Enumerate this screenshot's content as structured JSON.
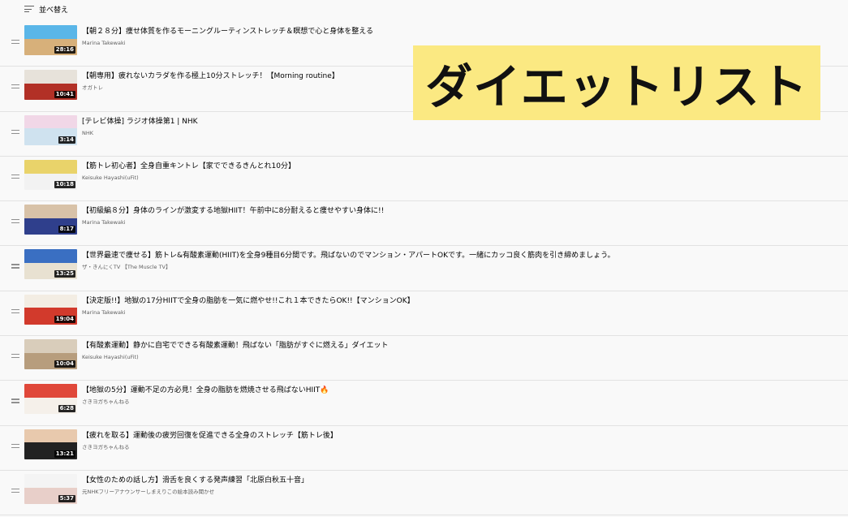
{
  "sort": {
    "label": "並べ替え"
  },
  "overlay": {
    "text": "ダイエットリスト"
  },
  "videos": [
    {
      "title": "【朝２８分】痩せ体質を作るモーニングルーティンストレッチ＆瞑想で心と身体を整える",
      "channel": "Marina Takewaki",
      "duration": "28:16",
      "thumb_text": "",
      "thumb_top": "#5ab6e8",
      "thumb_bottom": "#d7b07a"
    },
    {
      "title": "【朝専用】疲れないカラダを作る極上10分ストレッチ！【Morning routine】",
      "channel": "オガトレ",
      "duration": "10:41",
      "thumb_text": "",
      "thumb_top": "#e7e2da",
      "thumb_bottom": "#b23026"
    },
    {
      "title": "[テレビ体操] ラジオ体操第1 | NHK",
      "channel": "NHK",
      "duration": "3:14",
      "thumb_text": "",
      "thumb_top": "#f1d7e7",
      "thumb_bottom": "#cfe2ef"
    },
    {
      "title": "【筋トレ初心者】全身自重キントレ【家でできるきんとれ10分】",
      "channel": "Keisuke Hayashi(uFit)",
      "duration": "10:18",
      "thumb_text": "",
      "thumb_top": "#e9d36a",
      "thumb_bottom": "#f2f2f2"
    },
    {
      "title": "【初級編８分】身体のラインが激変する地獄HIIT！午前中に8分耐えると痩せやすい身体に!!",
      "channel": "Marina Takewaki",
      "duration": "8:17",
      "thumb_text": "",
      "thumb_top": "#d8c2a8",
      "thumb_bottom": "#2f3f8c"
    },
    {
      "title": "【世界最速で痩せる】筋トレ&有酸素運動(HIIT)を全身9種目6分間です。飛ばないのでマンション・アパートOKです。一緒にカッコ良く筋肉を引き締めましょう。",
      "channel": "ザ・きんにくTV 【The Muscle TV】",
      "duration": "13:25",
      "thumb_text": "",
      "thumb_top": "#3a6fc2",
      "thumb_bottom": "#e8e1d1"
    },
    {
      "title": "【決定版!!】地獄の17分HIITで全身の脂肪を一気に燃やせ!!これ１本できたらOK!!【マンションOK】",
      "channel": "Marina Takewaki",
      "duration": "19:04",
      "thumb_text": "",
      "thumb_top": "#f3ede3",
      "thumb_bottom": "#d23a2c"
    },
    {
      "title": "【有酸素運動】静かに自宅でできる有酸素運動！飛ばない「脂肪がすぐに燃える」ダイエット",
      "channel": "Keisuke Hayashi(uFit)",
      "duration": "10:04",
      "thumb_text": "",
      "thumb_top": "#d9cdbb",
      "thumb_bottom": "#b79d7d"
    },
    {
      "title": "【地獄の5分】運動不足の方必見！全身の脂肪を燃焼させる飛ばないHIIT🔥",
      "channel": "さきヨガちゃんねる",
      "duration": "6:28",
      "thumb_text": "",
      "thumb_top": "#e0483a",
      "thumb_bottom": "#f5f0ea"
    },
    {
      "title": "【疲れを取る】運動後の疲労回復を促進できる全身のストレッチ【筋トレ後】",
      "channel": "さきヨガちゃんねる",
      "duration": "13:21",
      "thumb_text": "",
      "thumb_top": "#e8c9ad",
      "thumb_bottom": "#222222"
    },
    {
      "title": "【女性のための話し方】滑舌を良くする発声練習「北原白秋五十音」",
      "channel": "元NHKフリーアナウンサーしまえりこの絵本読み聞かせ",
      "duration": "5:37",
      "thumb_text": "",
      "thumb_top": "#f4f4f4",
      "thumb_bottom": "#e8cfc9"
    }
  ]
}
